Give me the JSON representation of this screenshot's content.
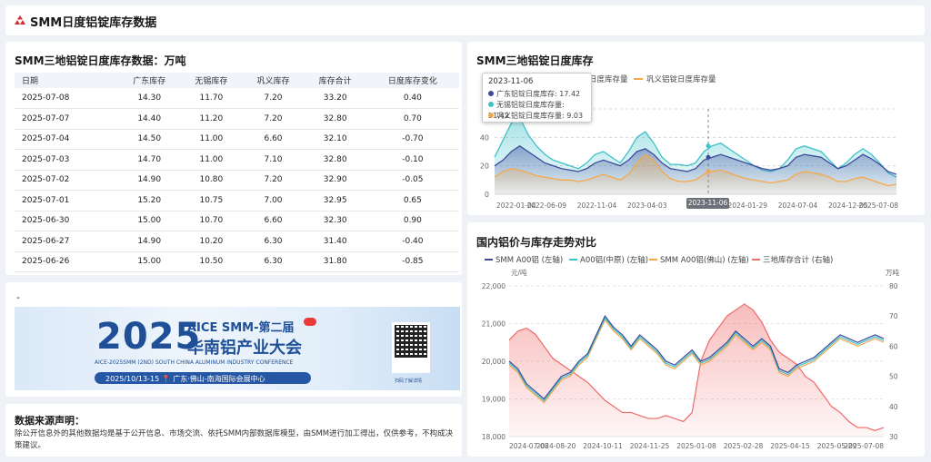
{
  "header": {
    "title": "SMM日度铝锭库存数据"
  },
  "table_panel": {
    "title": "SMM三地铝锭日度库存数据：万吨",
    "columns": [
      "日期",
      "广东库存",
      "无锡库存",
      "巩义库存",
      "库存合计",
      "日度库存变化"
    ],
    "rows": [
      [
        "2025-07-08",
        "14.30",
        "11.70",
        "7.20",
        "33.20",
        "0.40"
      ],
      [
        "2025-07-07",
        "14.40",
        "11.20",
        "7.20",
        "32.80",
        "0.70"
      ],
      [
        "2025-07-04",
        "14.50",
        "11.00",
        "6.60",
        "32.10",
        "-0.70"
      ],
      [
        "2025-07-03",
        "14.70",
        "11.00",
        "7.10",
        "32.80",
        "-0.10"
      ],
      [
        "2025-07-02",
        "14.90",
        "10.80",
        "7.20",
        "32.90",
        "-0.05"
      ],
      [
        "2025-07-01",
        "15.20",
        "10.75",
        "7.00",
        "32.95",
        "0.65"
      ],
      [
        "2025-06-30",
        "15.00",
        "10.70",
        "6.60",
        "32.30",
        "0.90"
      ],
      [
        "2025-06-27",
        "14.90",
        "10.20",
        "6.30",
        "31.40",
        "-0.40"
      ],
      [
        "2025-06-26",
        "15.00",
        "10.50",
        "6.30",
        "31.80",
        "-0.85"
      ]
    ]
  },
  "ad_panel": {
    "dash": "-",
    "banner": {
      "year": "2025",
      "line1": "AICE SMM-第二届",
      "line2": "华南铝产业大会",
      "line3": "AICE-2025SMM (2ND) SOUTH CHINA ALUMINUM INDUSTRY CONFERENCE",
      "line4": "2025/10/13-15  📍 广东·佛山-南海国际会展中心",
      "qr_caption": "扫码了解详情"
    }
  },
  "source_panel": {
    "title": "数据来源声明：",
    "body": "除公开信息外的其他数据均是基于公开信息、市场交流、依托SMM内部数据库模型，由SMM进行加工得出，仅供参考，不构成决策建议。"
  },
  "chart1_tooltip": {
    "date": "2023-11-06",
    "rows": [
      {
        "label": "广东铝锭日度库存: 17.42",
        "color": "#3b4a9c"
      },
      {
        "label": "无锡铝锭日度库存量: 21.42",
        "color": "#3fc1c9"
      },
      {
        "label": "巩义铝锭日度库存量: 9.03",
        "color": "#f4a84a"
      }
    ],
    "axis_pointer_label": "2023-11-06"
  },
  "chart_data": [
    {
      "type": "area",
      "title": "SMM三地铝锭日度库存",
      "legend_position": "top",
      "legend_visible": [
        "广东铝锭日度库存量",
        "巩义铝锭日度库存量"
      ],
      "x_tick_labels": [
        "2022-01-04",
        "2022-06-09",
        "2022-11-04",
        "2023-04-03",
        "2023-11-06",
        "2024-01-29",
        "2024-07-04",
        "2024-12-05",
        "2025-07-08"
      ],
      "y_tick_labels": [
        "0",
        "20",
        "40"
      ],
      "ylim": [
        0,
        60
      ],
      "grid": true,
      "series": [
        {
          "name": "广东铝锭日度库存量",
          "color": "#3b4a9c",
          "values": [
            20,
            24,
            30,
            34,
            30,
            26,
            22,
            20,
            18,
            17,
            16,
            18,
            22,
            24,
            22,
            20,
            24,
            30,
            32,
            28,
            22,
            18,
            17,
            16,
            18,
            24,
            26,
            28,
            26,
            24,
            22,
            20,
            18,
            17,
            18,
            20,
            26,
            28,
            27,
            26,
            22,
            18,
            20,
            24,
            28,
            25,
            21,
            16,
            14
          ]
        },
        {
          "name": "无锡铝锭日度库存量",
          "color": "#3fc1c9",
          "values": [
            26,
            38,
            50,
            54,
            42,
            34,
            28,
            24,
            22,
            20,
            18,
            22,
            28,
            30,
            26,
            22,
            30,
            40,
            44,
            36,
            26,
            21,
            21,
            20,
            22,
            30,
            34,
            36,
            32,
            28,
            24,
            20,
            17,
            16,
            18,
            24,
            32,
            34,
            32,
            30,
            24,
            18,
            22,
            28,
            32,
            28,
            22,
            15,
            12
          ]
        },
        {
          "name": "巩义铝锭日度库存量",
          "color": "#f4a84a",
          "values": [
            12,
            16,
            18,
            17,
            15,
            13,
            12,
            11,
            10,
            10,
            9,
            10,
            12,
            14,
            12,
            10,
            14,
            22,
            28,
            24,
            16,
            11,
            9,
            9,
            10,
            14,
            16,
            17,
            15,
            13,
            11,
            10,
            9,
            8,
            9,
            10,
            14,
            16,
            15,
            14,
            12,
            9,
            9,
            11,
            12,
            10,
            8,
            6,
            7
          ]
        }
      ]
    },
    {
      "type": "line",
      "title": "国内铝价与库存走势对比",
      "legend_position": "top",
      "left_axis_unit": "元/吨",
      "right_axis_unit": "万吨",
      "x_tick_labels": [
        "2024-07-08",
        "2024-08-20",
        "2024-10-11",
        "2024-11-25",
        "2025-01-08",
        "2025-02-28",
        "2025-04-15",
        "2025-05-29",
        "2025-07-08"
      ],
      "ylim_left": [
        18000,
        22000
      ],
      "ylim_right": [
        30,
        80
      ],
      "y_left_tick_labels": [
        "18,000",
        "19,000",
        "20,000",
        "21,000",
        "22,000"
      ],
      "y_right_tick_labels": [
        "30",
        "40",
        "50",
        "60",
        "70",
        "80"
      ],
      "grid": true,
      "series": [
        {
          "name": "SMM A00铝 (左轴)",
          "color": "#3b4a9c",
          "axis": "left",
          "values": [
            20000,
            19800,
            19400,
            19200,
            19000,
            19300,
            19600,
            19700,
            20000,
            20200,
            20700,
            21200,
            20900,
            20700,
            20400,
            20700,
            20500,
            20300,
            20000,
            19900,
            20100,
            20300,
            20000,
            20100,
            20300,
            20500,
            20800,
            20600,
            20400,
            20600,
            20400,
            19800,
            19700,
            19900,
            20000,
            20100,
            20300,
            20500,
            20700,
            20600,
            20500,
            20600,
            20700,
            20600
          ]
        },
        {
          "name": "A00铝(中原) (左轴)",
          "color": "#3fc1c9",
          "axis": "left",
          "values": [
            19950,
            19750,
            19350,
            19150,
            18950,
            19250,
            19550,
            19650,
            19950,
            20150,
            20650,
            21150,
            20850,
            20650,
            20350,
            20650,
            20450,
            20250,
            19950,
            19850,
            20050,
            20250,
            19950,
            20050,
            20250,
            20450,
            20750,
            20550,
            20350,
            20550,
            20350,
            19750,
            19650,
            19850,
            19950,
            20050,
            20250,
            20450,
            20650,
            20550,
            20450,
            20550,
            20650,
            20550
          ]
        },
        {
          "name": "SMM A00铝(佛山) (左轴)",
          "color": "#f4a84a",
          "axis": "left",
          "values": [
            19900,
            19700,
            19300,
            19100,
            18900,
            19200,
            19500,
            19600,
            19900,
            20100,
            20600,
            21100,
            20800,
            20600,
            20300,
            20600,
            20400,
            20200,
            19900,
            19800,
            20000,
            20200,
            19900,
            20000,
            20200,
            20400,
            20700,
            20500,
            20300,
            20500,
            20300,
            19700,
            19600,
            19800,
            19900,
            20000,
            20200,
            20400,
            20600,
            20500,
            20400,
            20500,
            20600,
            20500
          ]
        },
        {
          "name": "三地库存合计 (右轴)",
          "color": "#ef6a6a",
          "axis": "right",
          "values": [
            62,
            65,
            66,
            64,
            60,
            56,
            54,
            52,
            50,
            48,
            45,
            42,
            40,
            38,
            38,
            37,
            36,
            36,
            37,
            36,
            35,
            38,
            55,
            62,
            66,
            70,
            72,
            74,
            72,
            68,
            62,
            58,
            56,
            54,
            50,
            48,
            44,
            40,
            38,
            35,
            33,
            33,
            32,
            33
          ]
        }
      ]
    }
  ]
}
